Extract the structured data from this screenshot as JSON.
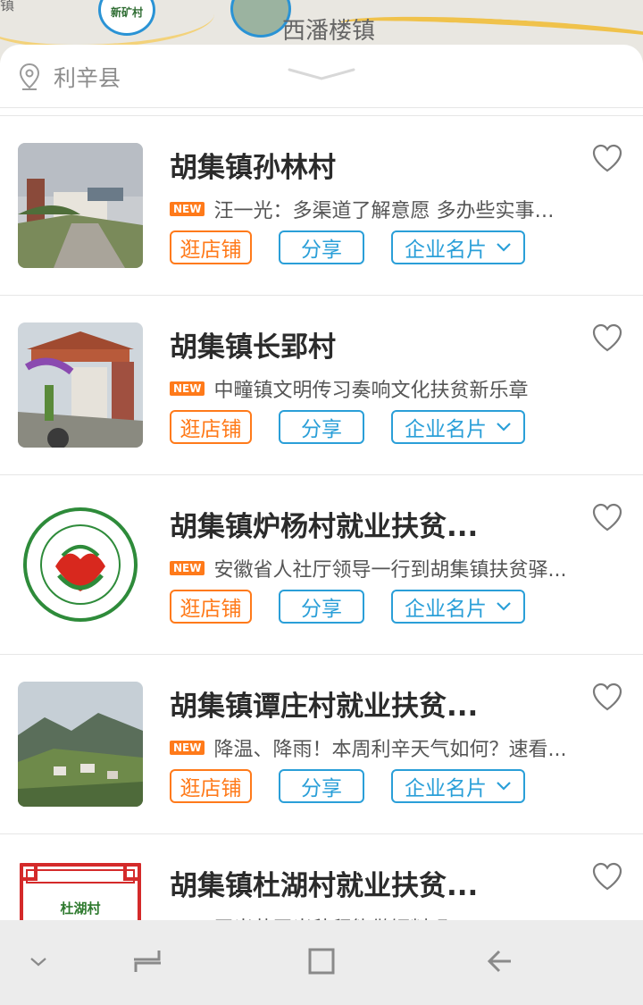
{
  "map": {
    "town_label": "西潘楼镇",
    "pin_label": "新矿村",
    "corner_label": "镇"
  },
  "header": {
    "location": "利辛县"
  },
  "buttons": {
    "shop": "逛店铺",
    "share": "分享",
    "card": "企业名片"
  },
  "badge": "NEW",
  "items": [
    {
      "title": "胡集镇孙林村",
      "news": "汪一光：多渠道了解意愿 多办些实事好事",
      "thumb": "village-road-photo"
    },
    {
      "title": "胡集镇长郢村",
      "news": "中疃镇文明传习奏响文化扶贫新乐章",
      "thumb": "village-gate-photo"
    },
    {
      "title": "胡集镇炉杨村就业扶贫...",
      "news": "安徽省人社厅领导一行到胡集镇扶贫驿...",
      "thumb": "poverty-relief-logo"
    },
    {
      "title": "胡集镇谭庄村就业扶贫...",
      "news": "降温、降雨！本周利辛天气如何？速看...",
      "thumb": "mountain-village-photo"
    },
    {
      "title": "胡集镇杜湖村就业扶贫...",
      "news": "玉米芯玉米秸秆能做饲料吗?",
      "thumb": "du-hu-village-card",
      "thumb_text": "杜湖村"
    }
  ],
  "colors": {
    "accent_orange": "#ff7a1a",
    "accent_blue": "#2a9fd8"
  }
}
